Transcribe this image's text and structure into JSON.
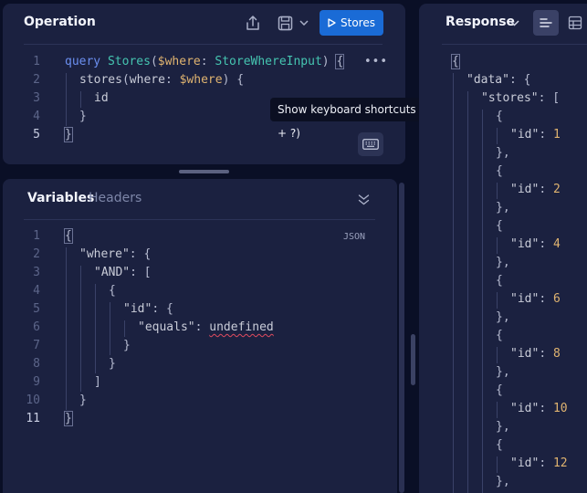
{
  "operation": {
    "title": "Operation",
    "run_label": "Stores",
    "more_label": "•••",
    "lines": [
      "1",
      "2",
      "3",
      "4",
      "5"
    ],
    "code": {
      "kw_query": "query",
      "op_name": "Stores",
      "var_where": "$where",
      "type_name": "StoreWhereInput",
      "field_stores": "stores",
      "arg_where": "where",
      "field_id": "id"
    }
  },
  "tooltip": {
    "text": "Show keyboard shortcuts (Option + ?)"
  },
  "variables": {
    "tab_variables": "Variables",
    "tab_headers": "Headers",
    "json_label": "JSON",
    "lines": [
      "1",
      "2",
      "3",
      "4",
      "5",
      "6",
      "7",
      "8",
      "9",
      "10",
      "11"
    ],
    "code": {
      "key_where": "\"where\"",
      "key_and": "\"AND\"",
      "key_id": "\"id\"",
      "key_equals": "\"equals\"",
      "val_undefined": "undefined"
    }
  },
  "response": {
    "title": "Response",
    "key_data": "\"data\"",
    "key_stores": "\"stores\"",
    "key_id": "\"id\"",
    "ids": [
      "1",
      "2",
      "4",
      "6",
      "8",
      "10",
      "12"
    ]
  },
  "colors": {
    "accent": "#1a6bd6",
    "panel": "#1b2140",
    "background": "#0a0f26"
  }
}
